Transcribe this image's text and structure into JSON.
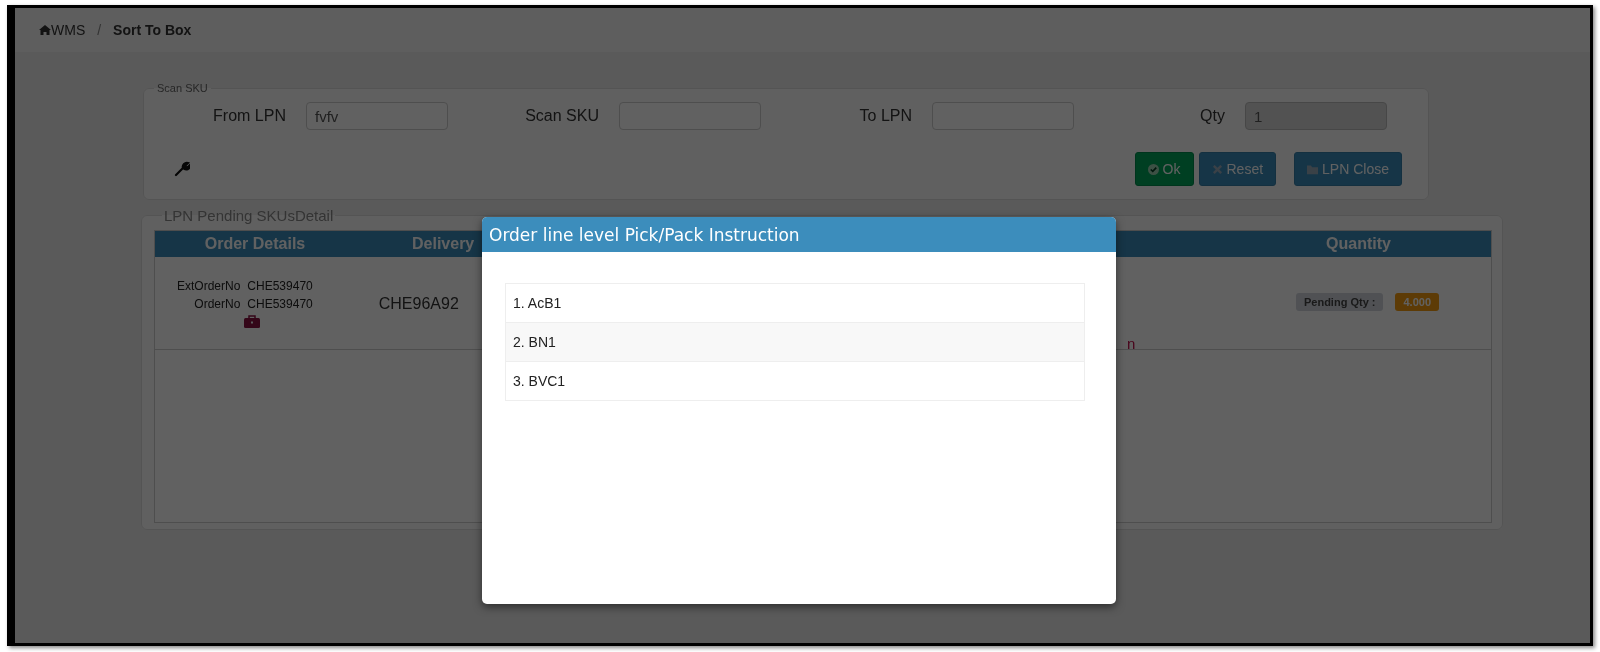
{
  "breadcrumb": {
    "separator": "/",
    "items": [
      {
        "label": "WMS"
      },
      {
        "label": "Sort To Box"
      }
    ]
  },
  "scan_panel": {
    "legend": "Scan SKU",
    "fields": [
      {
        "label": "From LPN",
        "value": "fvfv",
        "disabled": false
      },
      {
        "label": "Scan SKU",
        "disabled": false
      },
      {
        "label": "To LPN",
        "disabled": false
      },
      {
        "label": "Qty",
        "value": "1",
        "disabled": true
      }
    ],
    "buttons": [
      {
        "label": "Ok",
        "kind": "success"
      },
      {
        "label": "Reset",
        "kind": "primary"
      },
      {
        "label": "LPN Close",
        "kind": "primary"
      }
    ]
  },
  "pending_panel": {
    "legend": "LPN Pending SKUsDetail",
    "columns": [
      "Order Details",
      "Delivery"
    ],
    "last_column": "Quantity",
    "rows": [
      {
        "ext_order_label": "ExtOrderNo",
        "ext_order_no": "CHE539470",
        "order_label": "OrderNo",
        "order_no": "CHE539470",
        "delivery": "CHE96A92",
        "column_3": "n",
        "pending_label": "Pending Qty :",
        "pending_qty": "4.000"
      }
    ]
  },
  "modal": {
    "title": "Order line level Pick/Pack Instruction",
    "items": [
      "1. AcB1",
      "2. BN1",
      "3. BVC1"
    ]
  }
}
